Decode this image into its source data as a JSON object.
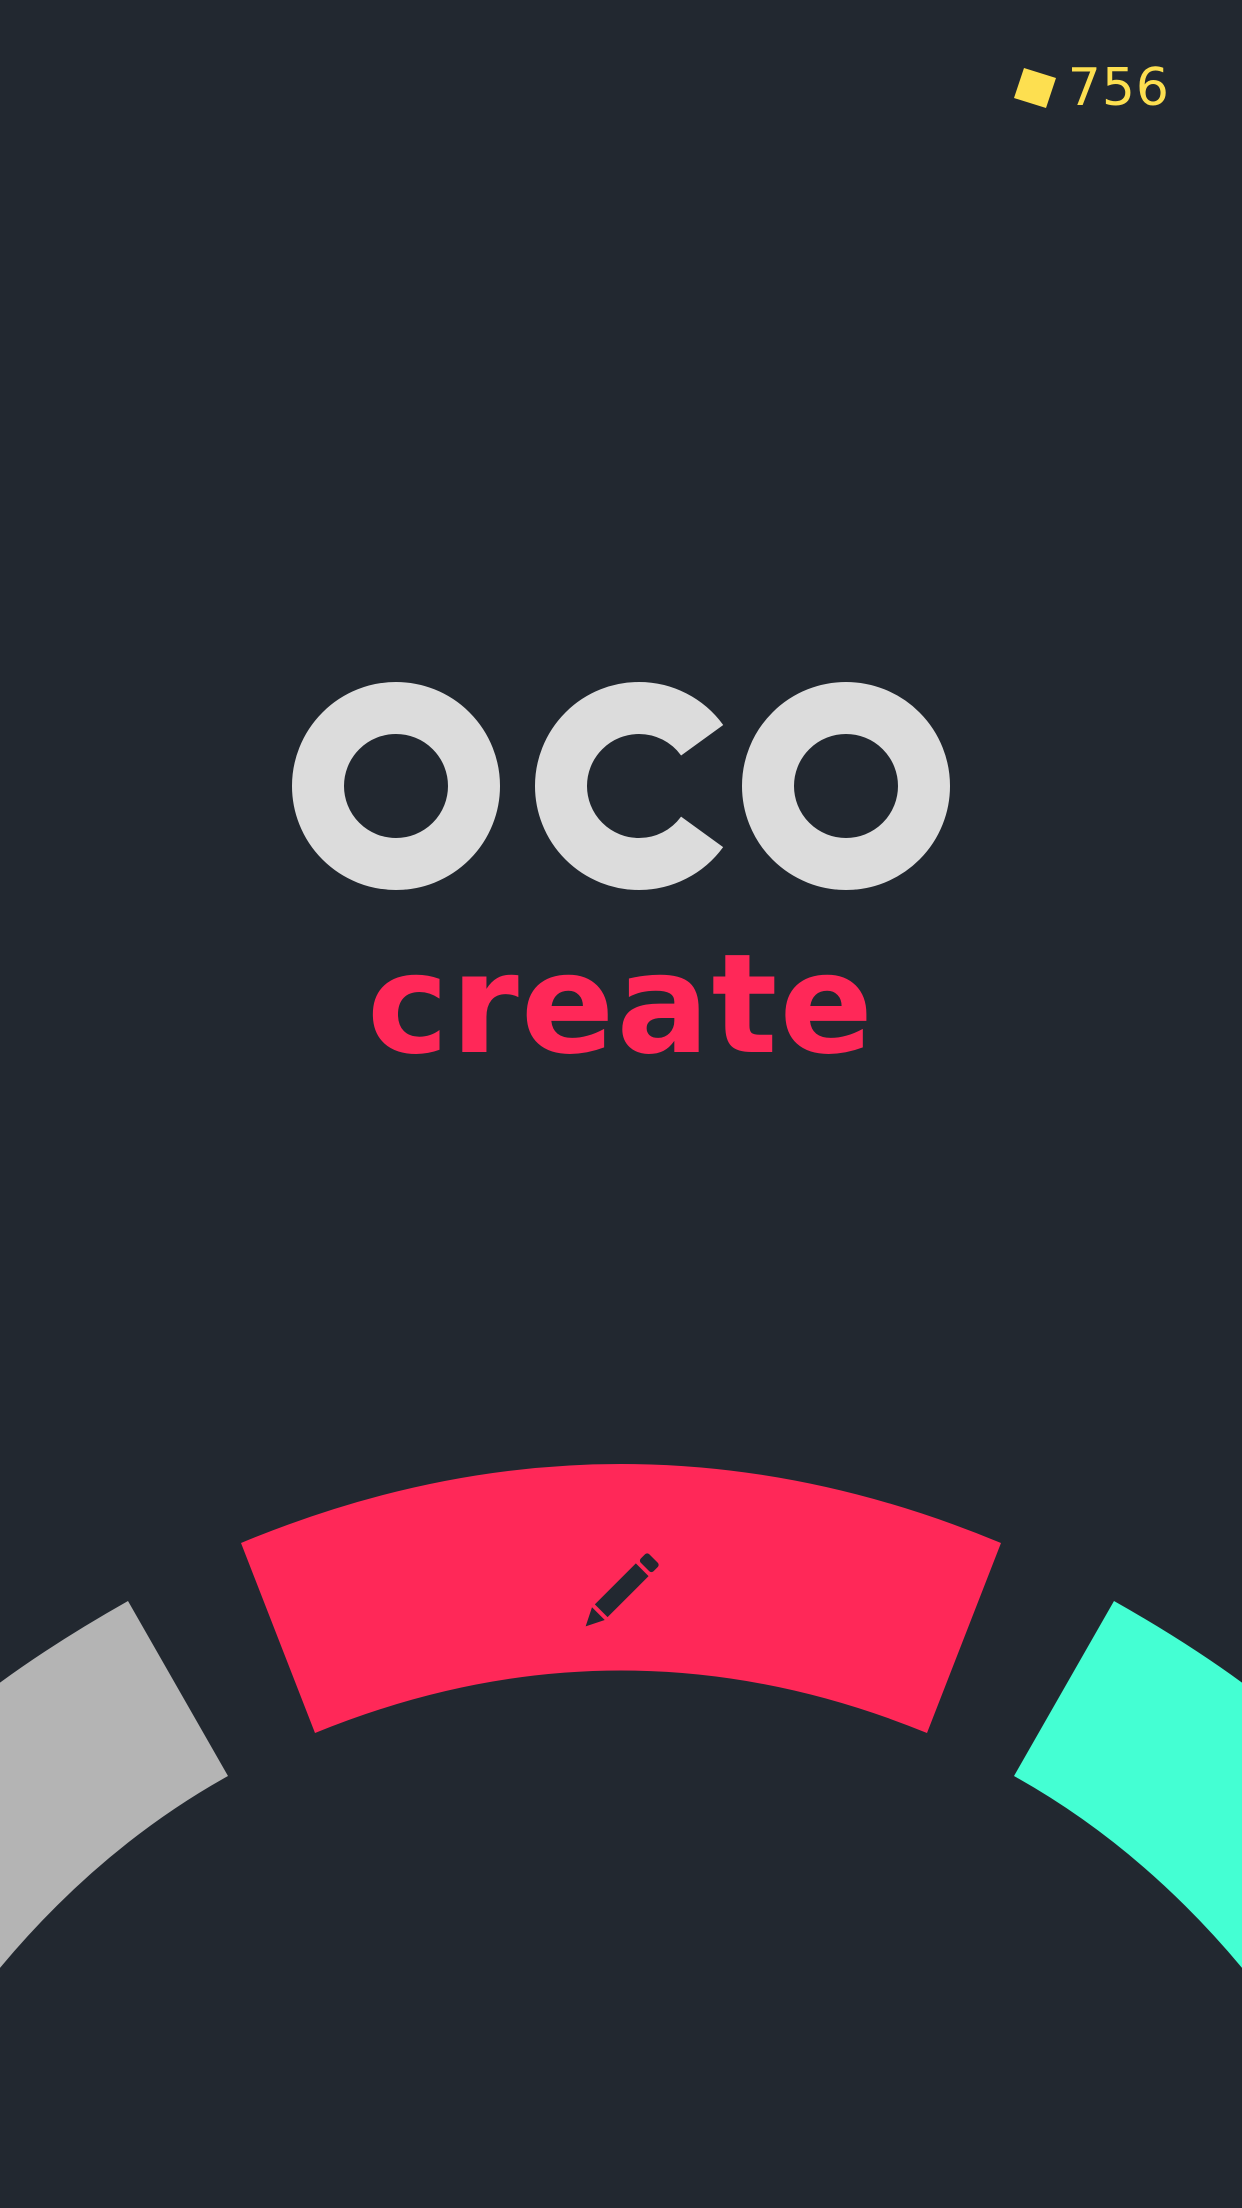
{
  "header": {
    "currency_icon": "yellow-gem-icon",
    "currency_count": "756"
  },
  "logo": {
    "letters": "OCO",
    "color": "#dcdcdc"
  },
  "mode": {
    "title": "create",
    "color": "#ff2858"
  },
  "mode_wheel": {
    "segments": [
      {
        "name": "grey-mode-segment",
        "color": "#b4b4b4",
        "icon": ""
      },
      {
        "name": "create-mode-segment",
        "color": "#ff2858",
        "icon": "pencil-icon",
        "selected": true
      },
      {
        "name": "teal-mode-segment",
        "color": "#44ffd3",
        "icon": ""
      }
    ]
  },
  "colors": {
    "background": "#222830",
    "currency": "#fddf50"
  }
}
